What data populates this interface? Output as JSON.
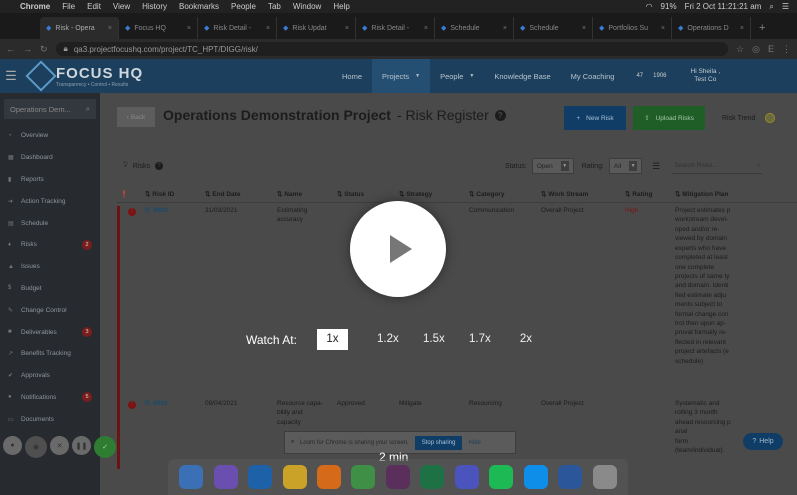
{
  "menubar": {
    "app": "Chrome",
    "items": [
      "File",
      "Edit",
      "View",
      "History",
      "Bookmarks",
      "People",
      "Tab",
      "Window",
      "Help"
    ],
    "battery": "91%",
    "datetime": "Fri 2 Oct  11:21:21 am"
  },
  "browser": {
    "tabs": [
      {
        "label": "Risk - Opera"
      },
      {
        "label": "Focus HQ"
      },
      {
        "label": "Risk Detail -"
      },
      {
        "label": "Risk Updat"
      },
      {
        "label": "Risk Detail -"
      },
      {
        "label": "Schedule"
      },
      {
        "label": "Schedule"
      },
      {
        "label": "Portfolios Su"
      },
      {
        "label": "Operations D"
      }
    ],
    "url": "qa3.projectfocushq.com/project/TC_HPT/DIGG/risk/",
    "profile_initial": "E"
  },
  "header": {
    "brand": "FOCUS HQ",
    "tagline": "Transparency • Control • Results",
    "nav": [
      {
        "label": "Home",
        "caret": false
      },
      {
        "label": "Projects",
        "caret": true
      },
      {
        "label": "People",
        "caret": true
      },
      {
        "label": "Knowledge Base",
        "caret": false
      },
      {
        "label": "My Coaching",
        "caret": false
      }
    ],
    "badge1": "47",
    "badge2": "1906",
    "user_line1": "Hi Sheila ,",
    "user_line2": "Test Co"
  },
  "sidebar": {
    "search_value": "Operations Dem...",
    "items": [
      {
        "label": "Overview",
        "icon": "gauge-icon",
        "count": ""
      },
      {
        "label": "Dashboard",
        "icon": "dashboard-icon",
        "count": ""
      },
      {
        "label": "Reports",
        "icon": "chart-icon",
        "count": ""
      },
      {
        "label": "Action Tracking",
        "icon": "arrow-icon",
        "count": ""
      },
      {
        "label": "Schedule",
        "icon": "calendar-icon",
        "count": ""
      },
      {
        "label": "Risks",
        "icon": "bulb-icon",
        "count": "2"
      },
      {
        "label": "Issues",
        "icon": "warning-icon",
        "count": ""
      },
      {
        "label": "Budget",
        "icon": "dollar-icon",
        "count": ""
      },
      {
        "label": "Change Control",
        "icon": "edit-icon",
        "count": ""
      },
      {
        "label": "Deliverables",
        "icon": "box-icon",
        "count": "3"
      },
      {
        "label": "Benefits Tracking",
        "icon": "trend-icon",
        "count": ""
      },
      {
        "label": "Approvals",
        "icon": "check-icon",
        "count": ""
      },
      {
        "label": "Notifications",
        "icon": "bell-icon",
        "count": "5"
      },
      {
        "label": "Documents",
        "icon": "doc-icon",
        "count": ""
      }
    ]
  },
  "page": {
    "back_label": "Back",
    "project_name": "Operations Demonstration Project",
    "title_suffix": " - Risk Register",
    "new_risk_label": "New Risk",
    "upload_label": "Upload Risks",
    "trend_label": "Risk Trend"
  },
  "filters": {
    "section_label": "Risks",
    "status_label": "Status:",
    "status_value": "Open",
    "rating_label": "Rating:",
    "rating_value": "All",
    "search_placeholder": "Search Risks..."
  },
  "table": {
    "columns": [
      "Risk ID",
      "End Date",
      "Name",
      "Status",
      "Strategy",
      "Category",
      "Work Stream",
      "Rating",
      "Mitigation Plan"
    ],
    "rows": [
      {
        "id": "R_0003",
        "end_date": "31/03/2021",
        "name": "Estimating\naccuracy",
        "status": "",
        "strategy": "Mitigate",
        "category": "Communication",
        "work_stream": "Overall Project",
        "rating": "High",
        "mitigation": "Project estimates p\nworkstream devel-\noped and/or re-\nviewed by domain\nexperts who have\ncompleted at least\none complete\nprojects of same ty\nand domain. Identi\nfied estimate adju\nments subject to\nformal change con\ntrol then upon ap-\nproval formally re-\nflected in relevant\nproject artefacts (e\nschedule)"
      },
      {
        "id": "R_0001",
        "end_date": "09/04/2021",
        "name": "Resource capa-\nbility and\ncapacity",
        "status": "Approved",
        "strategy": "Mitigate",
        "category": "Resourcing",
        "work_stream": "Overall Project",
        "rating": "",
        "mitigation": "Systematic and\nrolling 3 month\nahead resourcing p\nanal\nform\n(team/individual)."
      }
    ]
  },
  "video": {
    "watch_label": "Watch At:",
    "speeds": [
      "1x",
      "1.2x",
      "1.5x",
      "1.7x",
      "2x"
    ],
    "selected_speed": "1x",
    "duration": "2 min"
  },
  "loom": {
    "message": "Loom for Chrome is sharing your screen.",
    "stop_label": "Stop sharing",
    "hide_label": "Hide"
  },
  "help_label": "Help",
  "dock_apps": [
    {
      "name": "finder-icon",
      "color": "#3b6fb6"
    },
    {
      "name": "siri-icon",
      "color": "#6a4fb0"
    },
    {
      "name": "outlook-icon",
      "color": "#1d62a8"
    },
    {
      "name": "chrome-icon",
      "color": "#c9a227"
    },
    {
      "name": "firefox-icon",
      "color": "#d46a1a"
    },
    {
      "name": "maps-icon",
      "color": "#3f8f46"
    },
    {
      "name": "slack-icon",
      "color": "#5a2f5c"
    },
    {
      "name": "excel-icon",
      "color": "#1e7145"
    },
    {
      "name": "teams-icon",
      "color": "#4b53bc"
    },
    {
      "name": "spotify-icon",
      "color": "#1db954"
    },
    {
      "name": "teamviewer-icon",
      "color": "#0e8ee9"
    },
    {
      "name": "word-icon",
      "color": "#2b579a"
    },
    {
      "name": "trash-icon",
      "color": "#8a8a8a"
    }
  ]
}
